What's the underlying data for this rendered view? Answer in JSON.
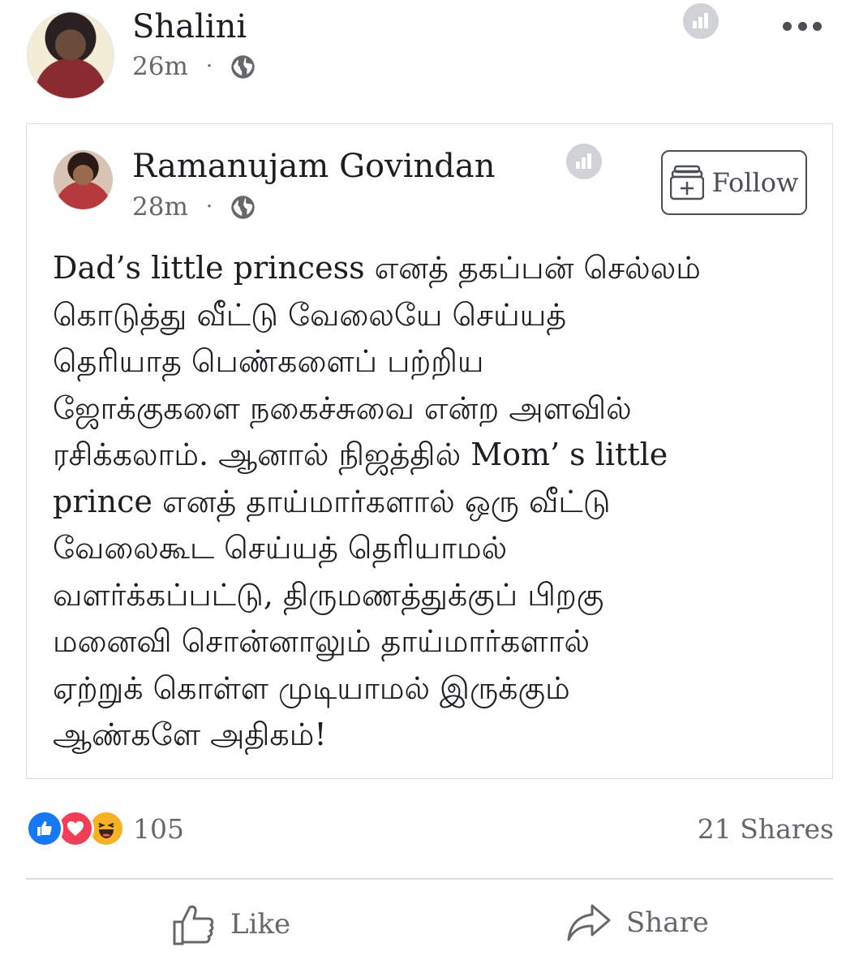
{
  "post": {
    "author": "Shalini",
    "time": "26m",
    "separator": "·"
  },
  "shared": {
    "author": "Ramanujam Govindan",
    "time": "28m",
    "separator": "·",
    "follow_label": "Follow",
    "text": "Dad’s little princess எனத் தகப்பன் செல்லம்\nகொடுத்து வீட்டு வேலையே செய்யத்\nதெரியாத பெண்களைப் பற்றிய\nஜோக்குகளை நகைச்சுவை என்ற அளவில்\nரசிக்கலாம். ஆனால் நிஜத்தில் Mom’ s little\nprince எனத் தாய்மார்களால் ஒரு வீட்டு\nவேலைகூட செய்யத் தெரியாமல்\nவளர்க்கப்பட்டு, திருமணத்துக்குப் பிறகு\nமனைவி சொன்னாலும் தாய்மார்களால்\nஏற்றுக் கொள்ள முடியாமல் இருக்கும்\nஆண்களே அதிகம்!"
  },
  "footer": {
    "reaction_count": "105",
    "shares": "21 Shares",
    "like_label": "Like",
    "share_label": "Share"
  },
  "icons": [
    "stats-icon",
    "more-icon",
    "globe-icon",
    "follow-icon",
    "like-reaction-icon",
    "love-reaction-icon",
    "haha-reaction-icon",
    "thumbs-up-icon",
    "share-arrow-icon"
  ],
  "colors": {
    "like_blue": "#1877f2",
    "love_red": "#f33e58",
    "haha_yellow": "#f7b125",
    "muted_text": "#65676b"
  }
}
